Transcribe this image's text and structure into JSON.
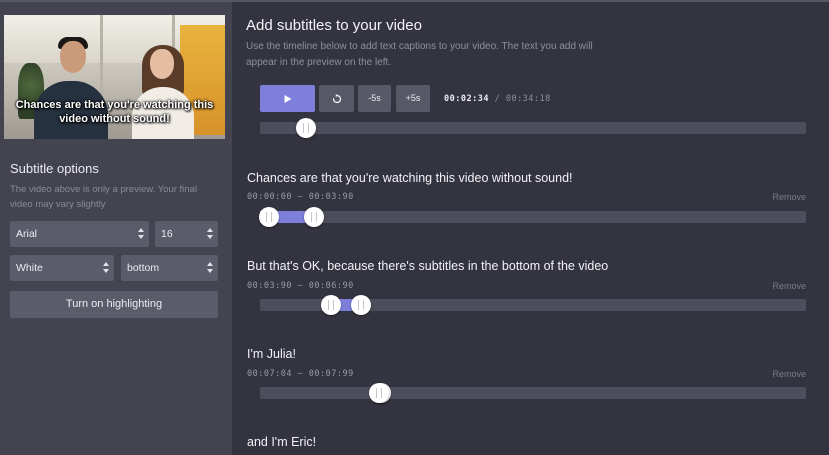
{
  "video": {
    "caption": "Chances are that you're watching this video without sound!"
  },
  "subtitle_options": {
    "title": "Subtitle options",
    "description": "The video above is only a preview. Your final video may vary slightly",
    "font": "Arial",
    "size": "16",
    "color": "White",
    "position": "bottom",
    "highlight_button": "Turn on highlighting"
  },
  "editor": {
    "title": "Add subtitles to your video",
    "intro": "Use the timeline below to add text captions to your video. The text you add will appear in the preview on the left.",
    "controls": {
      "play_icon": "play-icon",
      "replay_icon": "replay-icon",
      "back_label": "-5s",
      "forward_label": "+5s"
    },
    "current_time": "00:02:34",
    "separator": "/",
    "total_time": "00:34:18",
    "playhead_fraction": 0.07
  },
  "subtitles": [
    {
      "text": "Chances are that you're watching this video without sound!",
      "range": "00:00:00 – 00:03:90",
      "remove": "Remove",
      "start": 0.0,
      "end": 0.113
    },
    {
      "text": "But that's OK, because there's subtitles in the bottom of the video",
      "range": "00:03:90 – 00:06:90",
      "remove": "Remove",
      "start": 0.113,
      "end": 0.2
    },
    {
      "text": "I'm Julia!",
      "range": "00:07:04 – 00:07:99",
      "remove": "Remove",
      "start": 0.205,
      "end": 0.233
    },
    {
      "text": "and I'm Eric!"
    }
  ],
  "colors": {
    "accent": "#7d7fdb",
    "sidebar": "#434450",
    "main_bg": "#33343f",
    "track": "#4d4e5b"
  }
}
